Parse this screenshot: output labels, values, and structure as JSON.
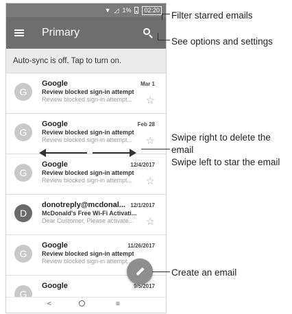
{
  "status_bar": {
    "battery": "1%",
    "time": "02:20"
  },
  "app_bar": {
    "title": "Primary"
  },
  "banner": {
    "text": "Auto-sync is off. Tap to turn on."
  },
  "emails": [
    {
      "avatar": "G",
      "sender": "Google",
      "date": "Mar 1",
      "subject": "Review blocked sign-in attempt",
      "preview": "Review blocked sign-in attempt..."
    },
    {
      "avatar": "G",
      "sender": "Google",
      "date": "Feb 28",
      "subject": "Review blocked sign-in attempt",
      "preview": "Review blocked sign-in attempt..."
    },
    {
      "avatar": "G",
      "sender": "Google",
      "date": "12/4/2017",
      "subject": "Review blocked sign-in attempt",
      "preview": "Review blocked sign-in attempt..."
    },
    {
      "avatar": "D",
      "sender": "donotreply@mcdonal...",
      "date": "12/1/2017",
      "subject": "McDonald's Free Wi-Fi Activati...",
      "preview": "Dear Customer, Please activate..."
    },
    {
      "avatar": "G",
      "sender": "Google",
      "date": "11/26/2017",
      "subject": "Review blocked sign-in attempt",
      "preview": "Review blocked sign-in attempt..."
    },
    {
      "avatar": "G",
      "sender": "Google",
      "date": "9/5/2017",
      "subject": "",
      "preview": ""
    }
  ],
  "nav_bar": {
    "back": "<",
    "recent": "≡"
  },
  "callouts": {
    "filter_starred": "Filter starred emails",
    "options_settings": "See options and settings",
    "swipe_right": "Swipe right to delete the",
    "swipe_right_2": "email",
    "swipe_left": "Swipe left to star the email",
    "create_email": "Create an email"
  },
  "colors": {
    "app_bar": "#6e6e6e",
    "status_bar": "#7a7a7a",
    "fab": "#8e8e8e",
    "banner": "#ebebeb"
  }
}
